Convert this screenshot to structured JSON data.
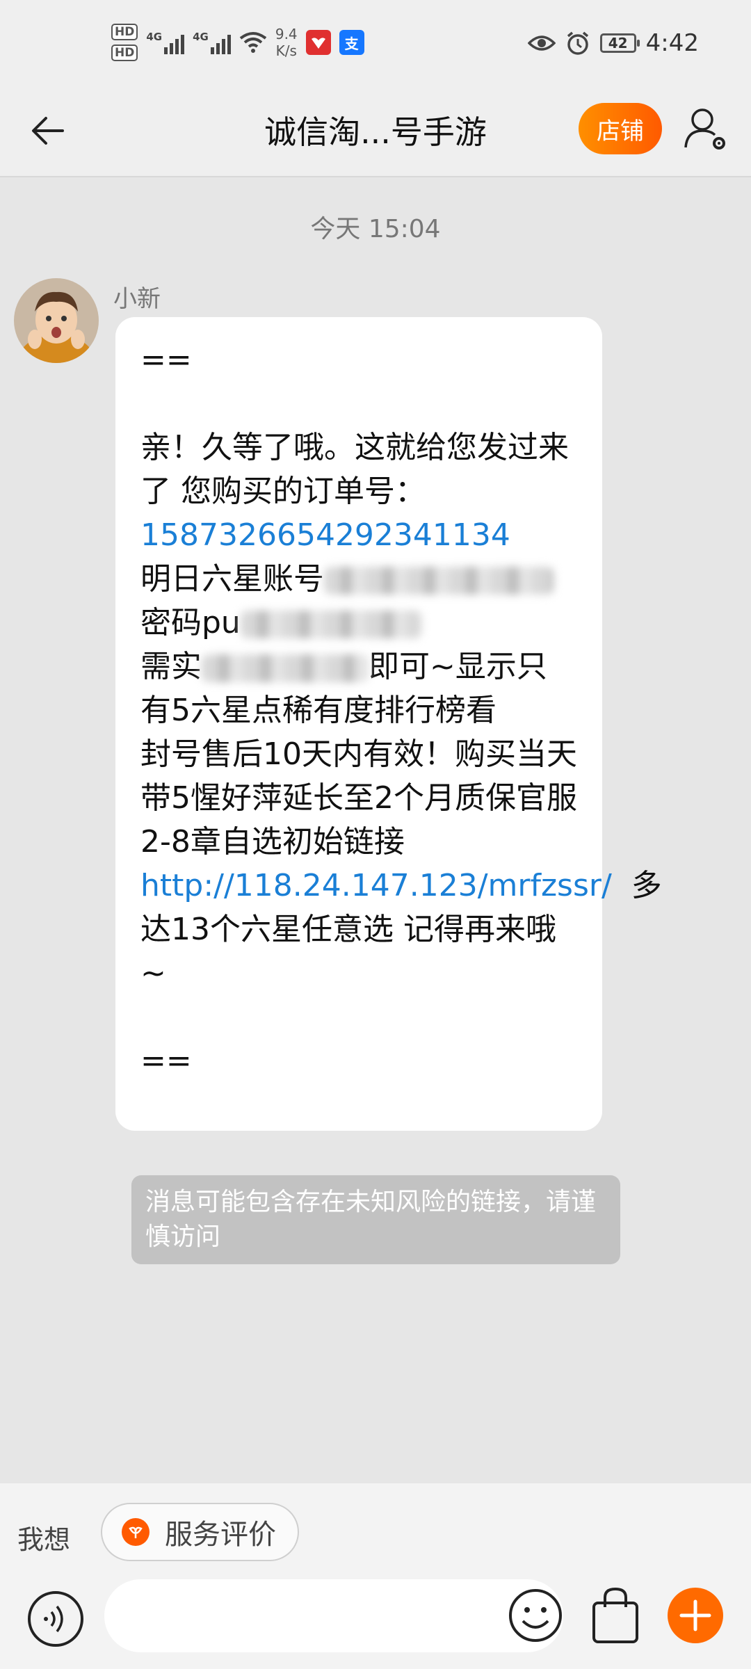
{
  "status_bar": {
    "hd1": "HD",
    "hd2": "HD",
    "sim1_type": "4G",
    "sim2_type": "4G",
    "net_speed_value": "9.4",
    "net_speed_unit": "K/s",
    "alipay_glyph": "支",
    "battery_level": "42",
    "time": "4:42"
  },
  "header": {
    "title": "诚信淘...号手游",
    "shop_label": "店铺"
  },
  "chat": {
    "timestamp": "今天  15:04",
    "sender_name": "小新",
    "message": {
      "line_open": "==",
      "greeting": "亲！久等了哦。这就给您发过来了 您购买的订单号：",
      "order_number": "1587326654292341134",
      "account_prefix": "明日六星账号",
      "password_prefix": "密码pu",
      "notice_prefix": "需实",
      "notice_rest": "即可~显示只有5六星点稀有度排行榜看",
      "warranty": "封号售后10天内有效！购买当天带5惺好萍延长至2个月质保官服2-8章自选初始链接",
      "link": "http://118.24.147.123/mrfzssr/",
      "closing": "多达13个六星任意选 记得再来哦~",
      "line_close": "=="
    },
    "risk_warning": "消息可能包含存在未知风险的链接，请谨慎访问"
  },
  "quick_actions": {
    "label": "我想",
    "service_rating": "服务评价"
  },
  "input_bar": {
    "placeholder": ""
  },
  "colors": {
    "accent_orange": "#ff6a00",
    "link_blue": "#1a7fd6",
    "background": "#e6e6e6"
  }
}
